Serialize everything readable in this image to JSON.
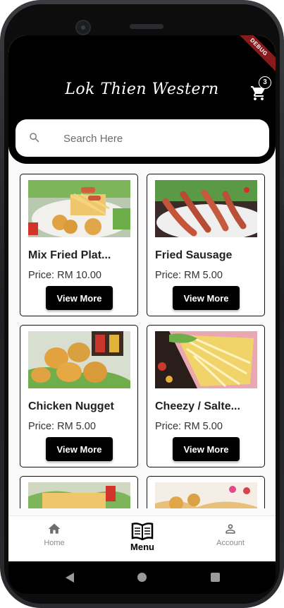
{
  "app": {
    "title": "Lok Thien Western",
    "debug_banner": "DEBUG",
    "cart_count": "3"
  },
  "search": {
    "placeholder": "Search Here"
  },
  "products": [
    {
      "name": "Mix Fried Plat...",
      "price": "Price: RM 10.00",
      "button": "View More"
    },
    {
      "name": "Fried Sausage",
      "price": "Price: RM 5.00",
      "button": "View More"
    },
    {
      "name": "Chicken Nugget",
      "price": "Price: RM 5.00",
      "button": "View More"
    },
    {
      "name": "Cheezy / Salte...",
      "price": "Price: RM 5.00",
      "button": "View More"
    },
    {
      "name": "",
      "price": "",
      "button": ""
    },
    {
      "name": "",
      "price": "",
      "button": ""
    }
  ],
  "bottom_nav": {
    "items": [
      {
        "label": "Home",
        "icon": "home-icon"
      },
      {
        "label": "Menu",
        "icon": "menu-book-icon"
      },
      {
        "label": "Account",
        "icon": "account-icon"
      }
    ],
    "active": "Menu"
  },
  "colors": {
    "appbar": "#000000",
    "accent": "#000000",
    "background": "#fafafa"
  }
}
